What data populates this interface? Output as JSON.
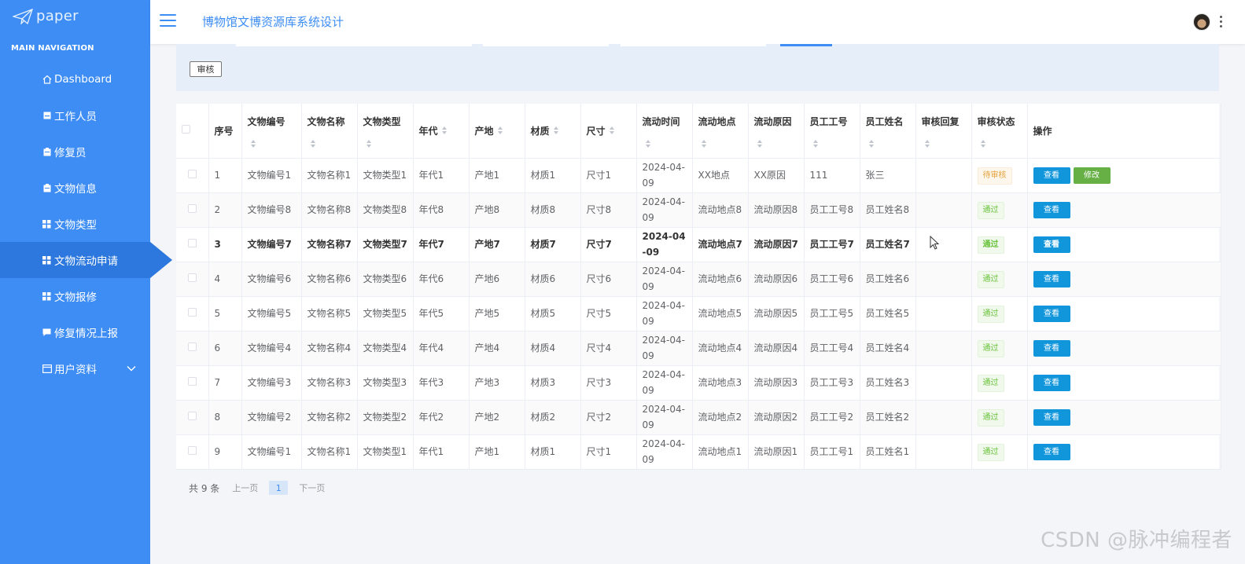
{
  "sidebar": {
    "logo_text": "paper",
    "nav_title": "MAIN NAVIGATION",
    "items": [
      {
        "label": "Dashboard",
        "icon": "home-icon"
      },
      {
        "label": "工作人员",
        "icon": "square-icon"
      },
      {
        "label": "修复员",
        "icon": "clipboard-icon"
      },
      {
        "label": "文物信息",
        "icon": "clipboard-icon"
      },
      {
        "label": "文物类型",
        "icon": "grid-icon"
      },
      {
        "label": "文物流动申请",
        "icon": "grid-icon",
        "active": true
      },
      {
        "label": "文物报修",
        "icon": "grid-icon"
      },
      {
        "label": "修复情况上报",
        "icon": "comment-icon"
      },
      {
        "label": "用户资料",
        "icon": "card-icon",
        "expandable": true
      }
    ]
  },
  "header": {
    "title": "博物馆文博资源库系统设计"
  },
  "search_panel": {
    "audit_button": "审核"
  },
  "table": {
    "columns": [
      "序号",
      "文物编号",
      "文物名称",
      "文物类型",
      "年代",
      "产地",
      "材质",
      "尺寸",
      "流动时间",
      "流动地点",
      "流动原因",
      "员工工号",
      "员工姓名",
      "审核回复",
      "审核状态",
      "操作"
    ],
    "rows": [
      {
        "no": "1",
        "code": "文物编号1",
        "name": "文物名称1",
        "type": "文物类型1",
        "era": "年代1",
        "origin": "产地1",
        "material": "材质1",
        "size": "尺寸1",
        "time": "2024-04-09",
        "place": "XX地点",
        "reason": "XX原因",
        "emp_no": "111",
        "emp_name": "张三",
        "reply": "",
        "status": "待审核",
        "status_kind": "pending",
        "actions": [
          "查看",
          "修改"
        ]
      },
      {
        "no": "2",
        "code": "文物编号8",
        "name": "文物名称8",
        "type": "文物类型8",
        "era": "年代8",
        "origin": "产地8",
        "material": "材质8",
        "size": "尺寸8",
        "time": "2024-04-09",
        "place": "流动地点8",
        "reason": "流动原因8",
        "emp_no": "员工工号8",
        "emp_name": "员工姓名8",
        "reply": "",
        "status": "通过",
        "status_kind": "pass",
        "actions": [
          "查看"
        ]
      },
      {
        "no": "3",
        "code": "文物编号7",
        "name": "文物名称7",
        "type": "文物类型7",
        "era": "年代7",
        "origin": "产地7",
        "material": "材质7",
        "size": "尺寸7",
        "time": "2024-04-09",
        "place": "流动地点7",
        "reason": "流动原因7",
        "emp_no": "员工工号7",
        "emp_name": "员工姓名7",
        "reply": "",
        "status": "通过",
        "status_kind": "pass",
        "actions": [
          "查看"
        ],
        "bold": true
      },
      {
        "no": "4",
        "code": "文物编号6",
        "name": "文物名称6",
        "type": "文物类型6",
        "era": "年代6",
        "origin": "产地6",
        "material": "材质6",
        "size": "尺寸6",
        "time": "2024-04-09",
        "place": "流动地点6",
        "reason": "流动原因6",
        "emp_no": "员工工号6",
        "emp_name": "员工姓名6",
        "reply": "",
        "status": "通过",
        "status_kind": "pass",
        "actions": [
          "查看"
        ]
      },
      {
        "no": "5",
        "code": "文物编号5",
        "name": "文物名称5",
        "type": "文物类型5",
        "era": "年代5",
        "origin": "产地5",
        "material": "材质5",
        "size": "尺寸5",
        "time": "2024-04-09",
        "place": "流动地点5",
        "reason": "流动原因5",
        "emp_no": "员工工号5",
        "emp_name": "员工姓名5",
        "reply": "",
        "status": "通过",
        "status_kind": "pass",
        "actions": [
          "查看"
        ]
      },
      {
        "no": "6",
        "code": "文物编号4",
        "name": "文物名称4",
        "type": "文物类型4",
        "era": "年代4",
        "origin": "产地4",
        "material": "材质4",
        "size": "尺寸4",
        "time": "2024-04-09",
        "place": "流动地点4",
        "reason": "流动原因4",
        "emp_no": "员工工号4",
        "emp_name": "员工姓名4",
        "reply": "",
        "status": "通过",
        "status_kind": "pass",
        "actions": [
          "查看"
        ]
      },
      {
        "no": "7",
        "code": "文物编号3",
        "name": "文物名称3",
        "type": "文物类型3",
        "era": "年代3",
        "origin": "产地3",
        "material": "材质3",
        "size": "尺寸3",
        "time": "2024-04-09",
        "place": "流动地点3",
        "reason": "流动原因3",
        "emp_no": "员工工号3",
        "emp_name": "员工姓名3",
        "reply": "",
        "status": "通过",
        "status_kind": "pass",
        "actions": [
          "查看"
        ]
      },
      {
        "no": "8",
        "code": "文物编号2",
        "name": "文物名称2",
        "type": "文物类型2",
        "era": "年代2",
        "origin": "产地2",
        "material": "材质2",
        "size": "尺寸2",
        "time": "2024-04-09",
        "place": "流动地点2",
        "reason": "流动原因2",
        "emp_no": "员工工号2",
        "emp_name": "员工姓名2",
        "reply": "",
        "status": "通过",
        "status_kind": "pass",
        "actions": [
          "查看"
        ]
      },
      {
        "no": "9",
        "code": "文物编号1",
        "name": "文物名称1",
        "type": "文物类型1",
        "era": "年代1",
        "origin": "产地1",
        "material": "材质1",
        "size": "尺寸1",
        "time": "2024-04-09",
        "place": "流动地点1",
        "reason": "流动原因1",
        "emp_no": "员工工号1",
        "emp_name": "员工姓名1",
        "reply": "",
        "status": "通过",
        "status_kind": "pass",
        "actions": [
          "查看"
        ]
      }
    ]
  },
  "pagination": {
    "total": "共 9 条",
    "prev": "上一页",
    "current": "1",
    "next": "下一页"
  },
  "watermark": "CSDN @脉冲编程者",
  "colors": {
    "sidebar": "#3d8df4",
    "accent": "#3d8df4",
    "view_button": "#1296db",
    "edit_button": "#67b046"
  }
}
